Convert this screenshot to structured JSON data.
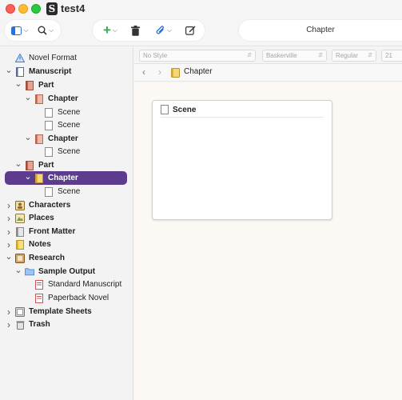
{
  "window": {
    "title": "test4",
    "app_icon_letter": "S"
  },
  "toolbar": {
    "header_title": "Chapter",
    "add_plus": "+"
  },
  "format": {
    "style": "No Style",
    "font": "Baskerville",
    "weight": "Regular",
    "size": "21"
  },
  "nav": {
    "title": "Chapter"
  },
  "card": {
    "title": "Scene"
  },
  "binder": [
    {
      "label": "Novel Format",
      "bold": false,
      "disclosure": "",
      "icon": "warning-icon"
    },
    {
      "label": "Manuscript",
      "bold": true,
      "disclosure": "v",
      "icon": "manuscript-icon"
    },
    {
      "label": "Part",
      "bold": true,
      "disclosure": "v",
      "icon": "part-icon"
    },
    {
      "label": "Chapter",
      "bold": true,
      "disclosure": "v",
      "icon": "chapter-icon"
    },
    {
      "label": "Scene",
      "bold": false,
      "disclosure": "",
      "icon": "document-icon"
    },
    {
      "label": "Scene",
      "bold": false,
      "disclosure": "",
      "icon": "document-icon"
    },
    {
      "label": "Chapter",
      "bold": true,
      "disclosure": "v",
      "icon": "chapter-icon"
    },
    {
      "label": "Scene",
      "bold": false,
      "disclosure": "",
      "icon": "document-icon"
    },
    {
      "label": "Part",
      "bold": true,
      "disclosure": "v",
      "icon": "part-icon"
    },
    {
      "label": "Chapter",
      "bold": true,
      "disclosure": "v",
      "icon": "folder-icon"
    },
    {
      "label": "Scene",
      "bold": false,
      "disclosure": "",
      "icon": "document-icon"
    },
    {
      "label": "Characters",
      "bold": true,
      "disclosure": ">",
      "icon": "characters-icon"
    },
    {
      "label": "Places",
      "bold": true,
      "disclosure": ">",
      "icon": "places-icon"
    },
    {
      "label": "Front Matter",
      "bold": true,
      "disclosure": ">",
      "icon": "front-matter-icon"
    },
    {
      "label": "Notes",
      "bold": true,
      "disclosure": ">",
      "icon": "notes-icon"
    },
    {
      "label": "Research",
      "bold": true,
      "disclosure": "v",
      "icon": "research-icon"
    },
    {
      "label": "Sample Output",
      "bold": true,
      "disclosure": "v",
      "icon": "blue-folder-icon"
    },
    {
      "label": "Standard Manuscript",
      "bold": false,
      "disclosure": "",
      "icon": "pdf-icon"
    },
    {
      "label": "Paperback Novel",
      "bold": false,
      "disclosure": "",
      "icon": "pdf-icon"
    },
    {
      "label": "Template Sheets",
      "bold": true,
      "disclosure": ">",
      "icon": "template-icon"
    },
    {
      "label": "Trash",
      "bold": true,
      "disclosure": ">",
      "icon": "trash-icon"
    }
  ],
  "colors": {
    "selection": "#5d3c8e",
    "corkboard": "#fcf9f5",
    "add_green": "#2fb24f"
  }
}
